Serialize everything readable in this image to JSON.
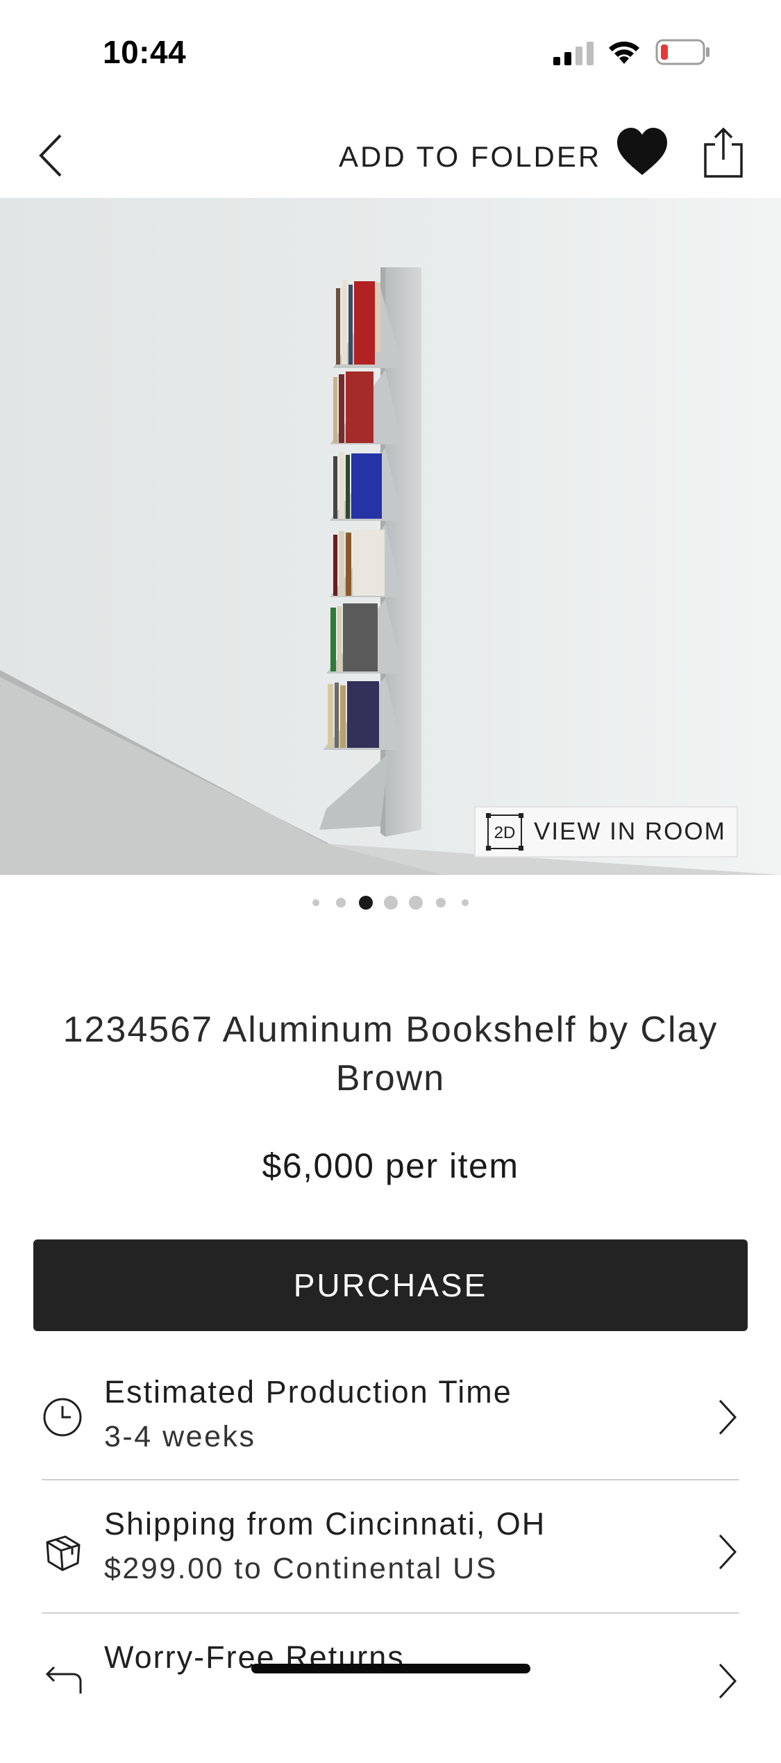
{
  "status_bar": {
    "time": "10:44"
  },
  "nav": {
    "add_to_folder_label": "ADD TO FOLDER"
  },
  "hero": {
    "view_in_room_label": "VIEW IN ROOM",
    "view_icon_text": "2D"
  },
  "carousel": {
    "total_dots": 7,
    "active_index": 2
  },
  "product": {
    "title": "1234567 Aluminum Bookshelf by Clay Brown",
    "price": "$6,000 per item"
  },
  "purchase_label": "PURCHASE",
  "info_rows": [
    {
      "icon": "clock-icon",
      "title": "Estimated Production Time",
      "subtitle": "3-4 weeks"
    },
    {
      "icon": "package-icon",
      "title": "Shipping from Cincinnati, OH",
      "subtitle": "$299.00 to Continental US"
    },
    {
      "icon": "return-icon",
      "title": "Worry-Free Returns",
      "subtitle": ""
    }
  ],
  "colors": {
    "primary": "#232323",
    "background": "#ffffff",
    "divider": "#cfcfcf",
    "battery_low": "#e53935"
  }
}
